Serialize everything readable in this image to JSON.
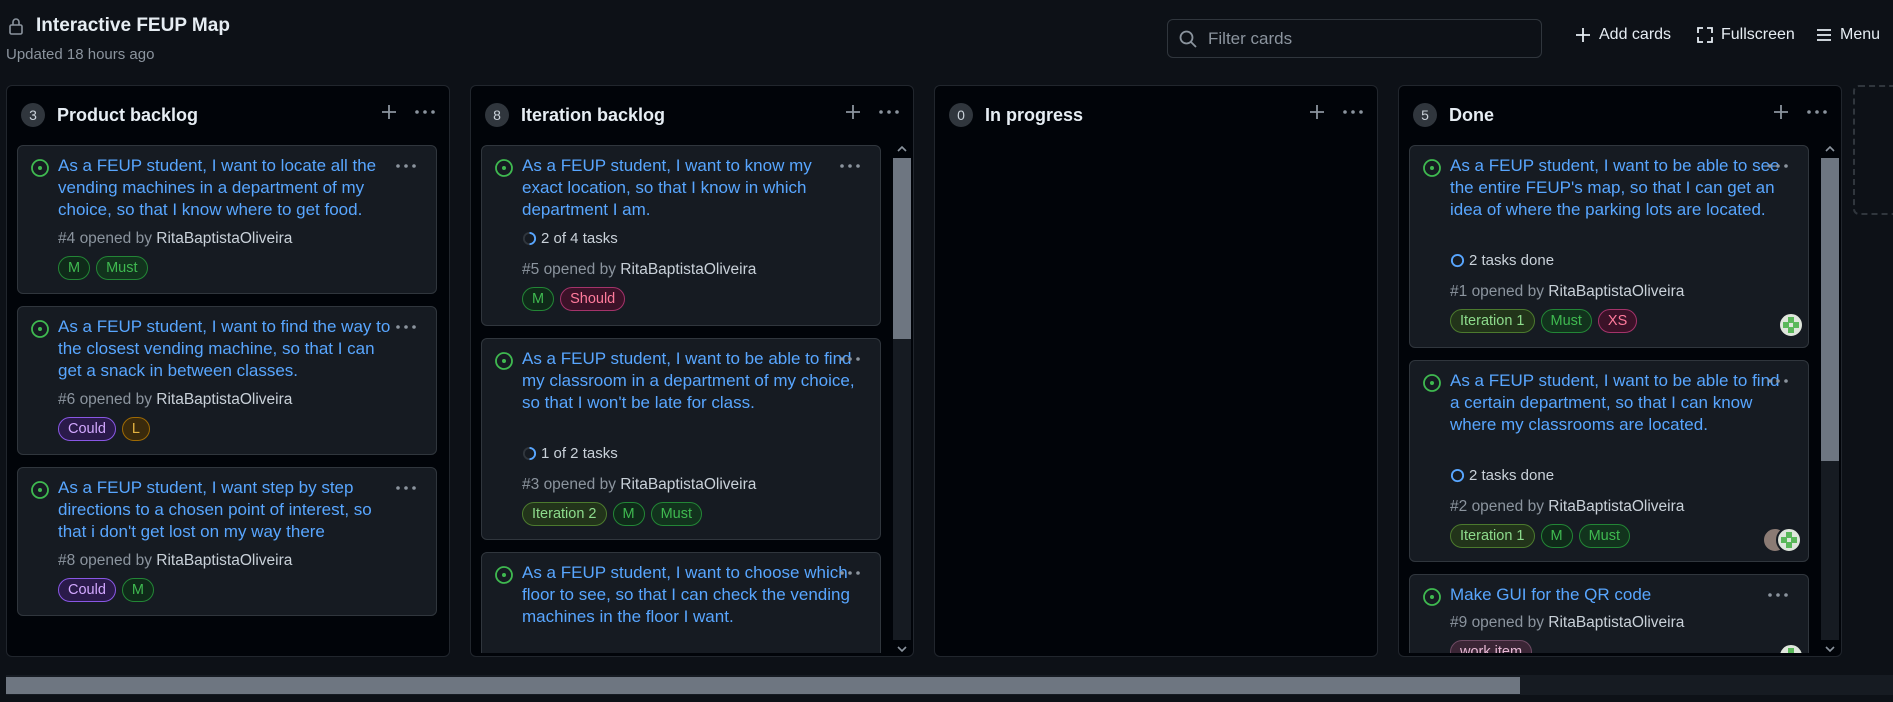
{
  "header": {
    "title": "Interactive FEUP Map",
    "updated": "Updated 18 hours ago",
    "search_placeholder": "Filter cards",
    "add_cards": "Add cards",
    "fullscreen": "Fullscreen",
    "menu": "Menu"
  },
  "colors": {
    "accent": "#58a6ff",
    "open_icon": "#3fb950",
    "bg": "#0d1117"
  },
  "columns": [
    {
      "name": "Product backlog",
      "count": "3",
      "cards": [
        {
          "title": "As a FEUP student, I want to locate all the vending machines in a department of my choice, so that I know where to get food.",
          "number": "#4",
          "opened_by": "opened by",
          "user": "RitaBaptistaOliveira",
          "labels": [
            "M",
            "Must"
          ]
        },
        {
          "title": "As a FEUP student, I want to find the way to the closest vending machine, so that I can get a snack in between classes.",
          "number": "#6",
          "opened_by": "opened by",
          "user": "RitaBaptistaOliveira",
          "labels": [
            "Could",
            "L"
          ]
        },
        {
          "title": "As a FEUP student, I want step by step directions to a chosen point of interest, so that i don't get lost on my way there",
          "number": "#8",
          "opened_by": "opened by",
          "user": "RitaBaptistaOliveira",
          "labels": [
            "Could",
            "M"
          ]
        }
      ]
    },
    {
      "name": "Iteration backlog",
      "count": "8",
      "cards": [
        {
          "title": "As a FEUP student, I want to know my exact location, so that I know in which department I am.",
          "tasks": "2 of 4 tasks",
          "number": "#5",
          "opened_by": "opened by",
          "user": "RitaBaptistaOliveira",
          "labels": [
            "M",
            "Should"
          ]
        },
        {
          "title": "As a FEUP student, I want to be able to find my classroom in a department of my choice, so that I won't be late for class.",
          "tasks": "1 of 2 tasks",
          "number": "#3",
          "opened_by": "opened by",
          "user": "RitaBaptistaOliveira",
          "labels": [
            "Iteration 2",
            "M",
            "Must"
          ]
        },
        {
          "title": "As a FEUP student, I want to choose which floor to see, so that I can check the vending machines in the floor I want."
        }
      ]
    },
    {
      "name": "In progress",
      "count": "0",
      "cards": []
    },
    {
      "name": "Done",
      "count": "5",
      "cards": [
        {
          "title": "As a FEUP student, I want to be able to see the entire FEUP's map, so that I can get an idea of where the parking lots are located.",
          "tasks": "2 tasks done",
          "number": "#1",
          "opened_by": "opened by",
          "user": "RitaBaptistaOliveira",
          "labels": [
            "Iteration 1",
            "Must",
            "XS"
          ]
        },
        {
          "title": "As a FEUP student, I want to be able to find a certain department, so that I can know where my classrooms are located.",
          "tasks": "2 tasks done",
          "number": "#2",
          "opened_by": "opened by",
          "user": "RitaBaptistaOliveira",
          "labels": [
            "Iteration 1",
            "M",
            "Must"
          ]
        },
        {
          "title": "Make GUI for the QR code",
          "number": "#9",
          "opened_by": "opened by",
          "user": "RitaBaptistaOliveira",
          "labels": [
            "work item"
          ]
        }
      ]
    }
  ]
}
